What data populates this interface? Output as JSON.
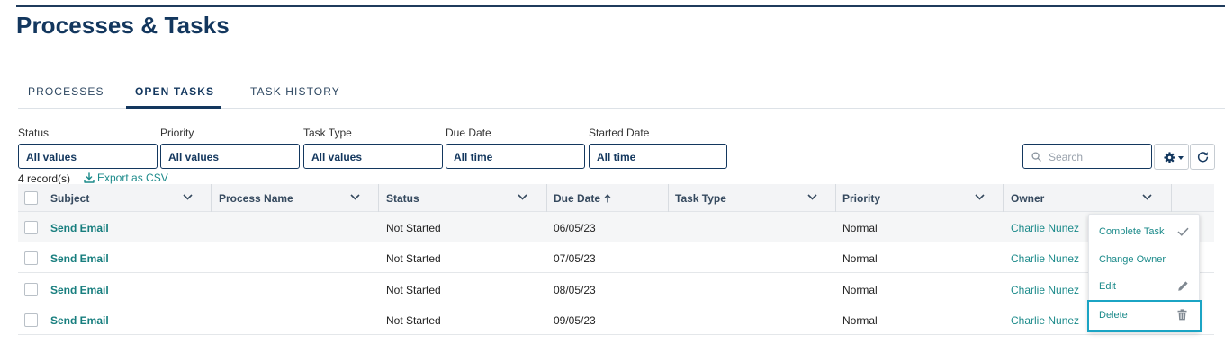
{
  "page": {
    "title": "Processes & Tasks"
  },
  "tabs": [
    {
      "label": "PROCESSES"
    },
    {
      "label": "OPEN TASKS",
      "active": true
    },
    {
      "label": "TASK HISTORY"
    }
  ],
  "filters": [
    {
      "label": "Status",
      "value": "All values"
    },
    {
      "label": "Priority",
      "value": "All values"
    },
    {
      "label": "Task Type",
      "value": "All values"
    },
    {
      "label": "Due Date",
      "value": "All time"
    },
    {
      "label": "Started Date",
      "value": "All time"
    }
  ],
  "search": {
    "placeholder": "Search",
    "icon": "search-icon"
  },
  "toolbar": {
    "settings_icon": "gear-icon",
    "refresh_icon": "refresh-icon"
  },
  "records": {
    "count_label": "4 record(s)",
    "export_label": "Export as CSV"
  },
  "table": {
    "columns": [
      "Subject",
      "Process Name",
      "Status",
      "Due Date",
      "Task Type",
      "Priority",
      "Owner"
    ],
    "sorted_column": "Due Date",
    "sort_direction": "ascending",
    "rows": [
      {
        "subject": "Send Email",
        "process_name": "",
        "status": "Not Started",
        "due_date": "06/05/23",
        "task_type": "",
        "priority": "Normal",
        "owner": "Charlie Nunez"
      },
      {
        "subject": "Send Email",
        "process_name": "",
        "status": "Not Started",
        "due_date": "07/05/23",
        "task_type": "",
        "priority": "Normal",
        "owner": "Charlie Nunez"
      },
      {
        "subject": "Send Email",
        "process_name": "",
        "status": "Not Started",
        "due_date": "08/05/23",
        "task_type": "",
        "priority": "Normal",
        "owner": "Charlie Nunez"
      },
      {
        "subject": "Send Email",
        "process_name": "",
        "status": "Not Started",
        "due_date": "09/05/23",
        "task_type": "",
        "priority": "Normal",
        "owner": "Charlie Nunez"
      }
    ]
  },
  "context_menu": {
    "items": [
      {
        "label": "Complete Task",
        "icon": "check-icon"
      },
      {
        "label": "Change Owner",
        "icon": ""
      },
      {
        "label": "Edit",
        "icon": "pencil-icon"
      },
      {
        "label": "Delete",
        "icon": "trash-icon",
        "highlighted": true
      }
    ]
  },
  "colors": {
    "primary": "#13375e",
    "link": "#1b8a8a",
    "highlight": "#1ba4c4"
  }
}
